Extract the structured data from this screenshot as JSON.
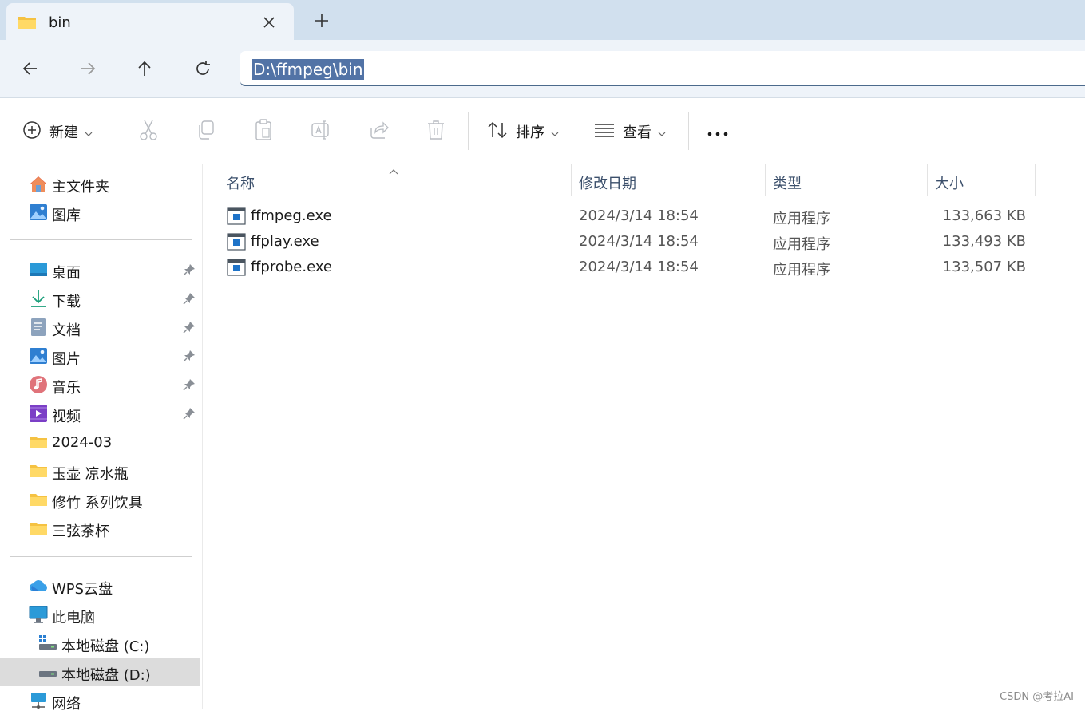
{
  "tab": {
    "title": "bin",
    "close_label": "×",
    "new_tab_label": "+"
  },
  "address": {
    "path": "D:\\ffmpeg\\bin"
  },
  "toolbar": {
    "new_label": "新建",
    "sort_label": "排序",
    "view_label": "查看",
    "more_label": "···"
  },
  "sidebar": {
    "top_items": [
      {
        "label": "主文件夹",
        "icon": "home-icon"
      },
      {
        "label": "图库",
        "icon": "gallery-icon"
      }
    ],
    "quick_items": [
      {
        "label": "桌面",
        "icon": "desktop-icon",
        "pinned": true
      },
      {
        "label": "下载",
        "icon": "download-icon",
        "pinned": true
      },
      {
        "label": "文档",
        "icon": "document-icon",
        "pinned": true
      },
      {
        "label": "图片",
        "icon": "pictures-icon",
        "pinned": true
      },
      {
        "label": "音乐",
        "icon": "music-icon",
        "pinned": true
      },
      {
        "label": "视频",
        "icon": "video-icon",
        "pinned": true
      },
      {
        "label": "2024-03",
        "icon": "folder-icon",
        "pinned": false
      },
      {
        "label": "玉壶 凉水瓶",
        "icon": "folder-icon",
        "pinned": false
      },
      {
        "label": "修竹 系列饮具",
        "icon": "folder-icon",
        "pinned": false
      },
      {
        "label": "三弦茶杯",
        "icon": "folder-icon",
        "pinned": false
      }
    ],
    "drive_items": [
      {
        "label": "WPS云盘",
        "icon": "cloud-icon"
      },
      {
        "label": "此电脑",
        "icon": "computer-icon"
      },
      {
        "label": "本地磁盘 (C:)",
        "icon": "drive-icon"
      },
      {
        "label": "本地磁盘 (D:)",
        "icon": "drive-icon",
        "selected": true
      },
      {
        "label": "网络",
        "icon": "network-icon"
      }
    ]
  },
  "columns": {
    "name": "名称",
    "modified": "修改日期",
    "type": "类型",
    "size": "大小"
  },
  "files": [
    {
      "name": "ffmpeg.exe",
      "modified": "2024/3/14 18:54",
      "type": "应用程序",
      "size": "133,663 KB"
    },
    {
      "name": "ffplay.exe",
      "modified": "2024/3/14 18:54",
      "type": "应用程序",
      "size": "133,493 KB"
    },
    {
      "name": "ffprobe.exe",
      "modified": "2024/3/14 18:54",
      "type": "应用程序",
      "size": "133,507 KB"
    }
  ],
  "watermark": "CSDN @考拉AI",
  "colors": {
    "accent": "#0067c0",
    "selection": "#5273a6",
    "tabbar": "#d1e0ee"
  }
}
